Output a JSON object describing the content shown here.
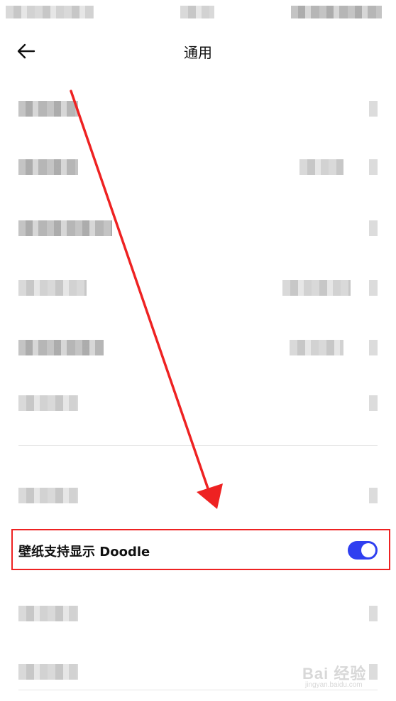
{
  "header": {
    "title": "通用",
    "back_icon": "arrow-left-icon"
  },
  "settings": {
    "doodle_label": "壁纸支持显示 Doodle",
    "doodle_enabled": true
  },
  "colors": {
    "toggle_on": "#2f3ff0",
    "annotation_red": "#ee2222"
  },
  "watermark": {
    "brand": "Bai 经验",
    "url": "jingyan.baidu.com"
  }
}
